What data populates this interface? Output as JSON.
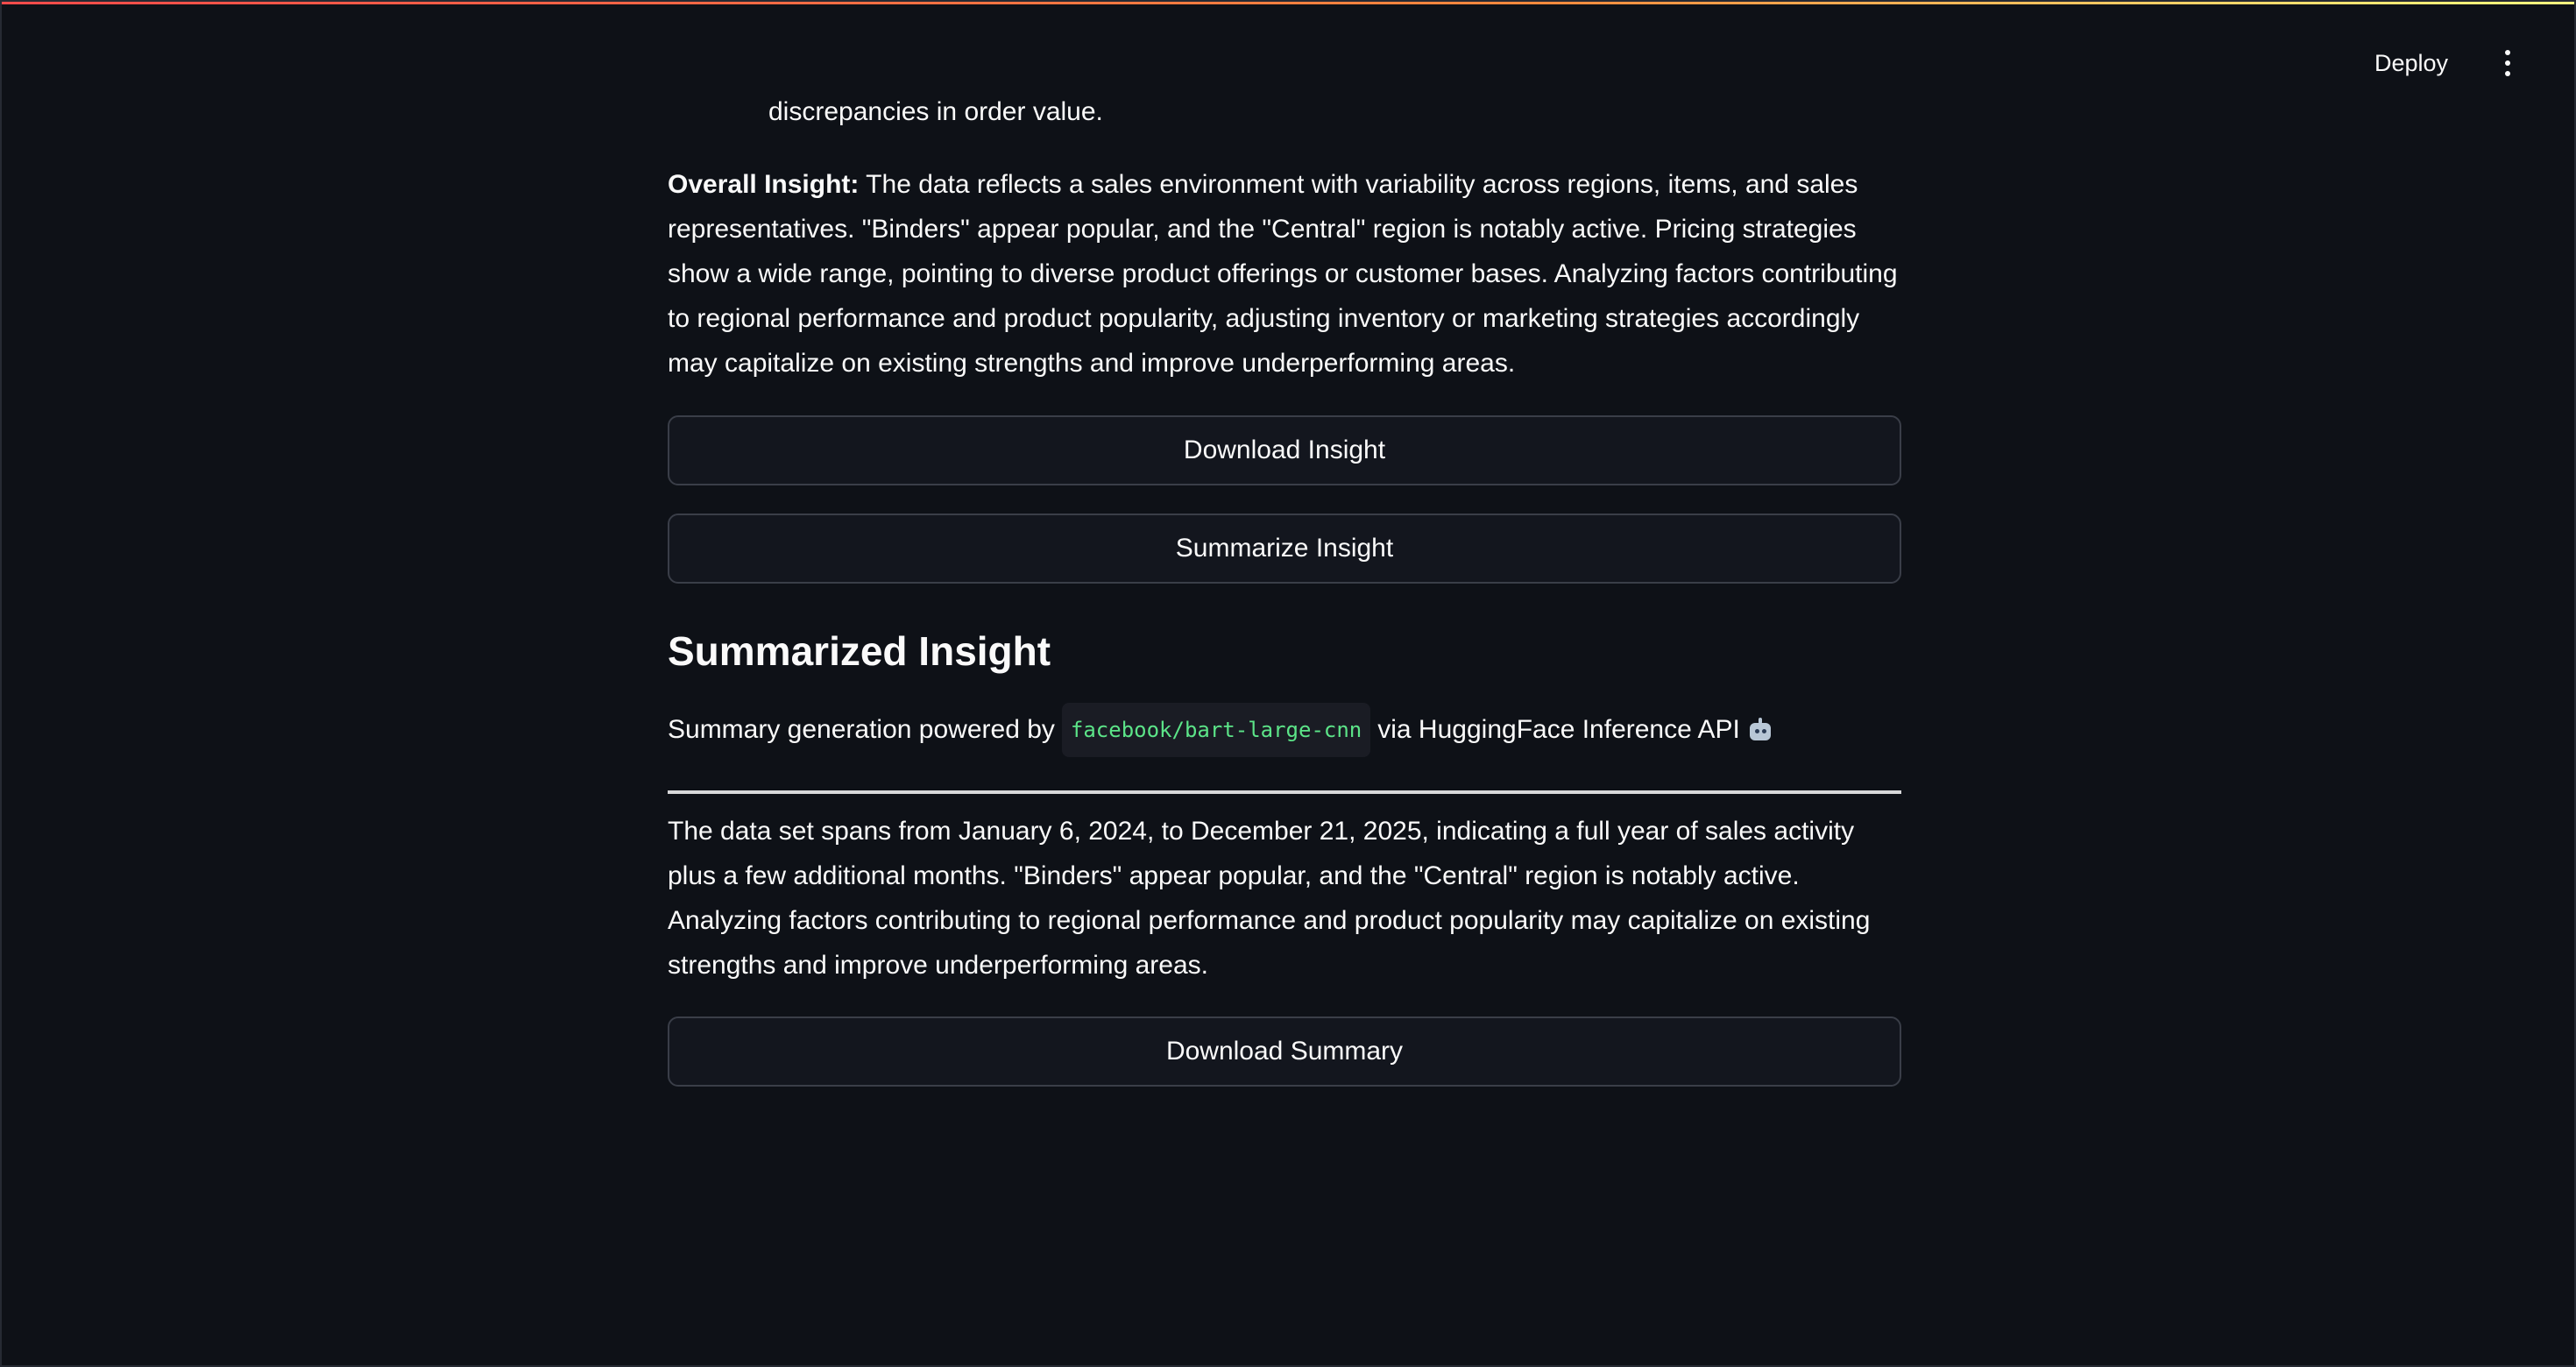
{
  "header": {
    "deploy_label": "Deploy",
    "menu_icon": "vertical-ellipsis-icon"
  },
  "content": {
    "list_tail": "discrepancies in order value.",
    "overall_insight": {
      "label": "Overall Insight:",
      "text": " The data reflects a sales environment with variability across regions, items, and sales representatives. \"Binders\" appear popular, and the \"Central\" region is notably active. Pricing strategies show a wide range, pointing to diverse product offerings or customer bases. Analyzing factors contributing to regional performance and product popularity, adjusting inventory or marketing strategies accordingly may capitalize on existing strengths and improve underperforming areas."
    },
    "download_insight_label": "Download Insight",
    "summarize_insight_label": "Summarize Insight",
    "summarized_title": "Summarized Insight",
    "powered_prefix": "Summary generation powered by",
    "model_name": "facebook/bart-large-cnn",
    "powered_suffix": "via HuggingFace Inference API",
    "powered_icon": "robot-icon",
    "summary_text": "The data set spans from January 6, 2024, to December 21, 2025, indicating a full year of sales activity plus a few additional months. \"Binders\" appear popular, and the \"Central\" region is notably active. Analyzing factors contributing to regional performance and product popularity may capitalize on existing strengths and improve underperforming areas.",
    "download_summary_label": "Download Summary"
  },
  "colors": {
    "background": "#0e1117",
    "text": "#fafafa",
    "button_bg": "#13161e",
    "button_border": "#3a3e48",
    "code_text": "#5ce488"
  }
}
